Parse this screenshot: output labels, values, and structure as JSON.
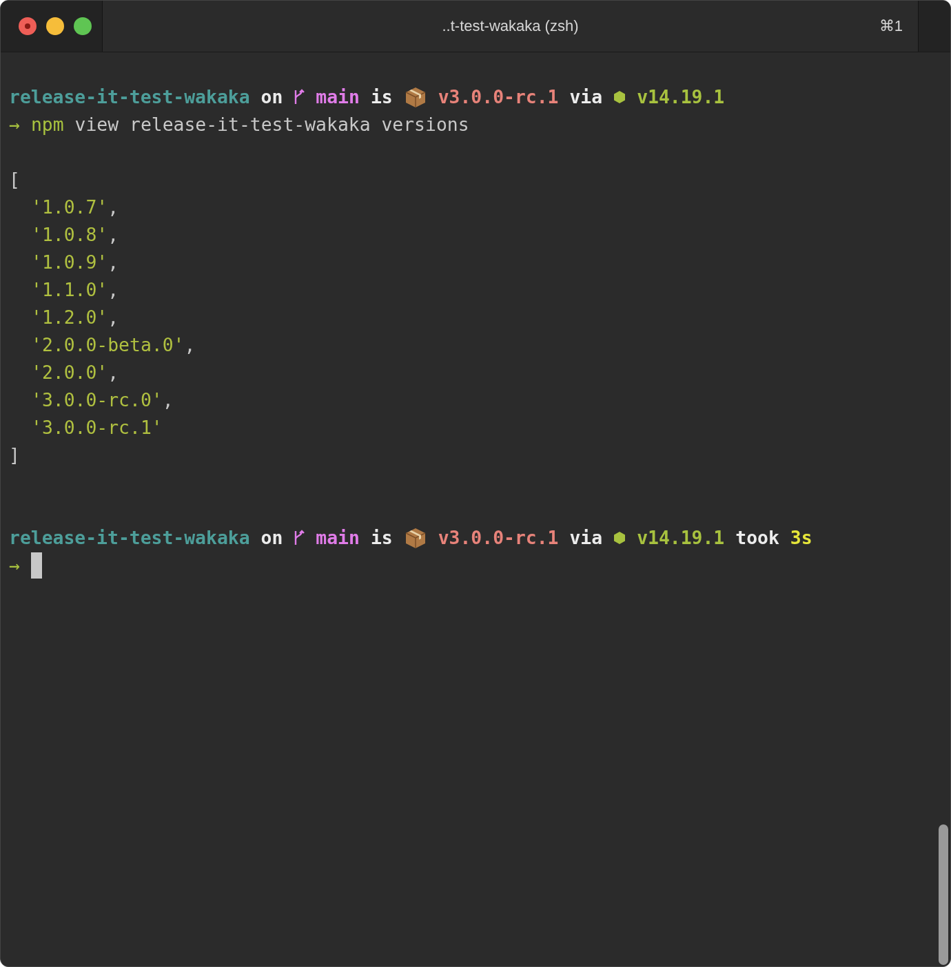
{
  "window": {
    "title": "..t-test-wakaka (zsh)",
    "shortcut": "⌘1"
  },
  "lines": [
    {
      "kind": "prompt",
      "segments": [
        {
          "kind": "dir",
          "text": "release-it-test-wakaka"
        },
        {
          "kind": "word",
          "text": "on"
        },
        {
          "kind": "branch",
          "text": "main"
        },
        {
          "kind": "word",
          "text": "is"
        },
        {
          "kind": "package",
          "text": "v3.0.0-rc.1"
        },
        {
          "kind": "word",
          "text": "via"
        },
        {
          "kind": "node",
          "text": "v14.19.1"
        }
      ]
    },
    {
      "kind": "command",
      "symbol": "→",
      "program": "npm",
      "args": "view release-it-test-wakaka versions"
    },
    {
      "kind": "blank"
    },
    {
      "kind": "output",
      "indented": false,
      "segments": [
        {
          "kind": "punct",
          "text": "["
        }
      ]
    },
    {
      "kind": "output",
      "indented": true,
      "segments": [
        {
          "kind": "string",
          "text": "'1.0.7'"
        },
        {
          "kind": "punct",
          "text": ","
        }
      ]
    },
    {
      "kind": "output",
      "indented": true,
      "segments": [
        {
          "kind": "string",
          "text": "'1.0.8'"
        },
        {
          "kind": "punct",
          "text": ","
        }
      ]
    },
    {
      "kind": "output",
      "indented": true,
      "segments": [
        {
          "kind": "string",
          "text": "'1.0.9'"
        },
        {
          "kind": "punct",
          "text": ","
        }
      ]
    },
    {
      "kind": "output",
      "indented": true,
      "segments": [
        {
          "kind": "string",
          "text": "'1.1.0'"
        },
        {
          "kind": "punct",
          "text": ","
        }
      ]
    },
    {
      "kind": "output",
      "indented": true,
      "segments": [
        {
          "kind": "string",
          "text": "'1.2.0'"
        },
        {
          "kind": "punct",
          "text": ","
        }
      ]
    },
    {
      "kind": "output",
      "indented": true,
      "segments": [
        {
          "kind": "string",
          "text": "'2.0.0-beta.0'"
        },
        {
          "kind": "punct",
          "text": ","
        }
      ]
    },
    {
      "kind": "output",
      "indented": true,
      "segments": [
        {
          "kind": "string",
          "text": "'2.0.0'"
        },
        {
          "kind": "punct",
          "text": ","
        }
      ]
    },
    {
      "kind": "output",
      "indented": true,
      "segments": [
        {
          "kind": "string",
          "text": "'3.0.0-rc.0'"
        },
        {
          "kind": "punct",
          "text": ","
        }
      ]
    },
    {
      "kind": "output",
      "indented": true,
      "segments": [
        {
          "kind": "string",
          "text": "'3.0.0-rc.1'"
        }
      ]
    },
    {
      "kind": "output",
      "indented": false,
      "segments": [
        {
          "kind": "punct",
          "text": "]"
        }
      ]
    },
    {
      "kind": "blank"
    },
    {
      "kind": "blank"
    },
    {
      "kind": "prompt",
      "segments": [
        {
          "kind": "dir",
          "text": "release-it-test-wakaka"
        },
        {
          "kind": "word",
          "text": "on"
        },
        {
          "kind": "branch",
          "text": "main"
        },
        {
          "kind": "word",
          "text": "is"
        },
        {
          "kind": "package",
          "text": "v3.0.0-rc.1"
        },
        {
          "kind": "word",
          "text": "via"
        },
        {
          "kind": "node",
          "text": "v14.19.1"
        },
        {
          "kind": "word",
          "text": "took"
        },
        {
          "kind": "duration",
          "text": "3s"
        }
      ]
    },
    {
      "kind": "input",
      "symbol": "→",
      "cursor": true
    }
  ]
}
